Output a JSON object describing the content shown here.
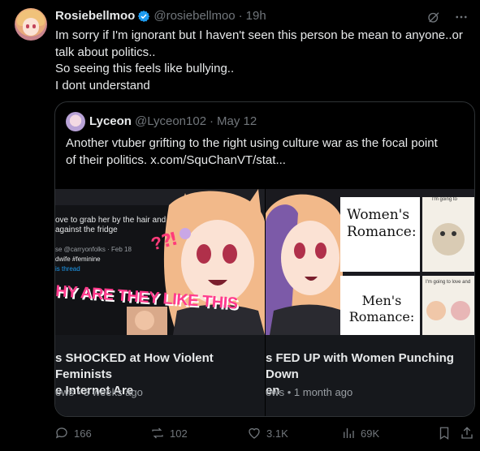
{
  "author": {
    "name": "Rosiebellmoo",
    "handle": "@rosiebellmoo",
    "time": "19h"
  },
  "tweet": {
    "lines": [
      "Im sorry if I'm ignorant but I haven't seen this person be mean to anyone..or",
      "talk about politics..",
      "So seeing this feels like bullying..",
      "I dont understand"
    ]
  },
  "quote": {
    "name": "Lyceon",
    "handle": "@Lyceon102",
    "date": "May 12",
    "lines": [
      "Another vtuber grifting to the right using culture war as the focal point",
      "of their politics.  x.com/SquChanVT/stat..."
    ],
    "cards": [
      {
        "overlay_lines": [
          "ove to grab her by the hair and",
          "against the fridge"
        ],
        "overlay_handle": "se @carryonfolks · Feb 18",
        "overlay_tag": "dwife #feminine",
        "overlay_link": "is thread",
        "banner": "HY ARE THEY LIKE THIS",
        "exclaim": "?⁈",
        "title_lines": [
          "s SHOCKED at How Violent Feminists",
          "e Internet Are"
        ],
        "meta": "ews • 3 weeks ago"
      },
      {
        "panel_top": "Women's Romance:",
        "panel_bottom": "Men's Romance:",
        "side_top": "I'm going to",
        "side_bottom": "I'm going to love and",
        "title_lines": [
          "s FED UP with Women Punching Down",
          "en"
        ],
        "meta": "ews • 1 month ago"
      }
    ]
  },
  "actions": {
    "replies": "166",
    "reposts": "102",
    "likes": "3.1K",
    "views": "69K"
  },
  "colors": {
    "background": "#000000",
    "text": "#e7e9ea",
    "muted": "#71767b",
    "verified": "#1d9bf0",
    "border": "#2f3336"
  }
}
